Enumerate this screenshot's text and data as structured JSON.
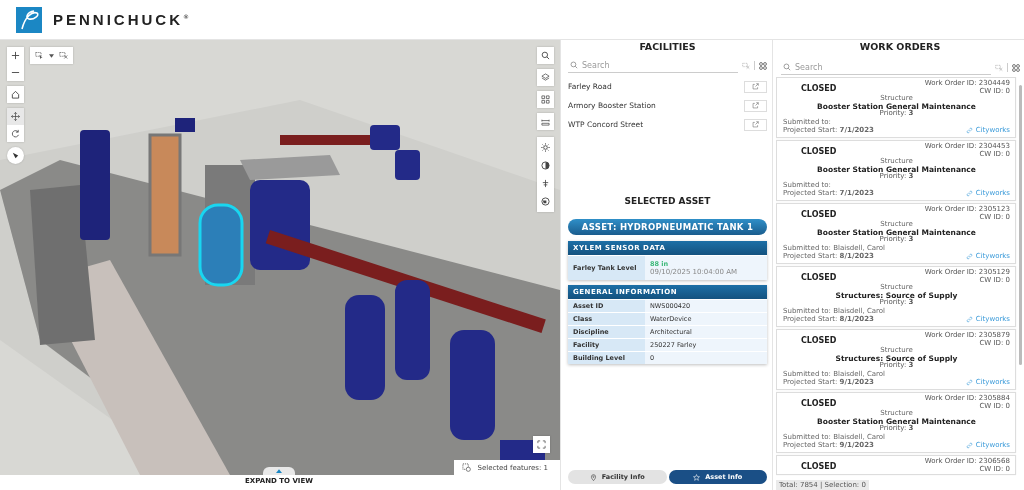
{
  "header": {
    "brand": "PENNICHUCK",
    "brand_mark": "®"
  },
  "map": {
    "selected_features": "Selected features: 1",
    "expand_label": "EXPAND TO VIEW"
  },
  "facilities": {
    "title": "FACILITIES",
    "search": {
      "placeholder": "Search"
    },
    "items": [
      {
        "name": "Farley Road"
      },
      {
        "name": "Armory Booster Station"
      },
      {
        "name": "WTP Concord Street"
      }
    ]
  },
  "selected_asset": {
    "title": "SELECTED ASSET",
    "asset_name": "ASSET: HYDROPNEUMATIC TANK 1",
    "sensor": {
      "heading": "XYLEM SENSOR DATA",
      "label": "Farley Tank Level",
      "value": "88 in",
      "timestamp": "09/10/2025 10:04:00 AM"
    },
    "general": {
      "heading": "GENERAL INFORMATION",
      "rows": [
        {
          "label": "Asset ID",
          "value": "NWS000420"
        },
        {
          "label": "Class",
          "value": "WaterDevice"
        },
        {
          "label": "Discipline",
          "value": "Architectural"
        },
        {
          "label": "Facility",
          "value": "250227 Farley"
        },
        {
          "label": "Building Level",
          "value": "0"
        }
      ]
    }
  },
  "panel_tabs": [
    {
      "label": "Facility Info",
      "selected": false
    },
    {
      "label": "Asset Info",
      "selected": true
    }
  ],
  "work_orders": {
    "title": "WORK ORDERS",
    "search": {
      "placeholder": "Search"
    },
    "cards": [
      {
        "status": "CLOSED",
        "wo_id": "Work Order ID: 2304449",
        "cw_id": "CW ID: 0",
        "category": "Structure",
        "description": "Booster Station General Maintenance",
        "priority": "Priority: **3**",
        "submitted": "Submitted to:",
        "start": "Projected Start: **7/1/2023**",
        "link": "Cityworks"
      },
      {
        "status": "CLOSED",
        "wo_id": "Work Order ID: 2304453",
        "cw_id": "CW ID: 0",
        "category": "Structure",
        "description": "Booster Station General Maintenance",
        "priority": "Priority: **3**",
        "submitted": "Submitted to:",
        "start": "Projected Start: **7/1/2023**",
        "link": "Cityworks"
      },
      {
        "status": "CLOSED",
        "wo_id": "Work Order ID: 2305123",
        "cw_id": "CW ID: 0",
        "category": "Structure",
        "description": "Booster Station General Maintenance",
        "priority": "Priority: **3**",
        "submitted": "Submitted to: Blaisdell, Carol",
        "start": "Projected Start: **8/1/2023**",
        "link": "Cityworks"
      },
      {
        "status": "CLOSED",
        "wo_id": "Work Order ID: 2305129",
        "cw_id": "CW ID: 0",
        "category": "Structure",
        "description": "Structures: Source of Supply",
        "priority": "Priority: **3**",
        "submitted": "Submitted to: Blaisdell, Carol",
        "start": "Projected Start: **8/1/2023**",
        "link": "Cityworks"
      },
      {
        "status": "CLOSED",
        "wo_id": "Work Order ID: 2305879",
        "cw_id": "CW ID: 0",
        "category": "Structure",
        "description": "Structures: Source of Supply",
        "priority": "Priority: **3**",
        "submitted": "Submitted to: Blaisdell, Carol",
        "start": "Projected Start: **9/1/2023**",
        "link": "Cityworks"
      },
      {
        "status": "CLOSED",
        "wo_id": "Work Order ID: 2305884",
        "cw_id": "CW ID: 0",
        "category": "Structure",
        "description": "Booster Station General Maintenance",
        "priority": "Priority: **3**",
        "submitted": "Submitted to: Blaisdell, Carol",
        "start": "Projected Start: **9/1/2023**",
        "link": "Cityworks"
      },
      {
        "status": "CLOSED",
        "wo_id": "Work Order ID: 2306568",
        "cw_id": "CW ID: 0"
      }
    ],
    "footer": "Total: 7854 | Selection: 0"
  }
}
